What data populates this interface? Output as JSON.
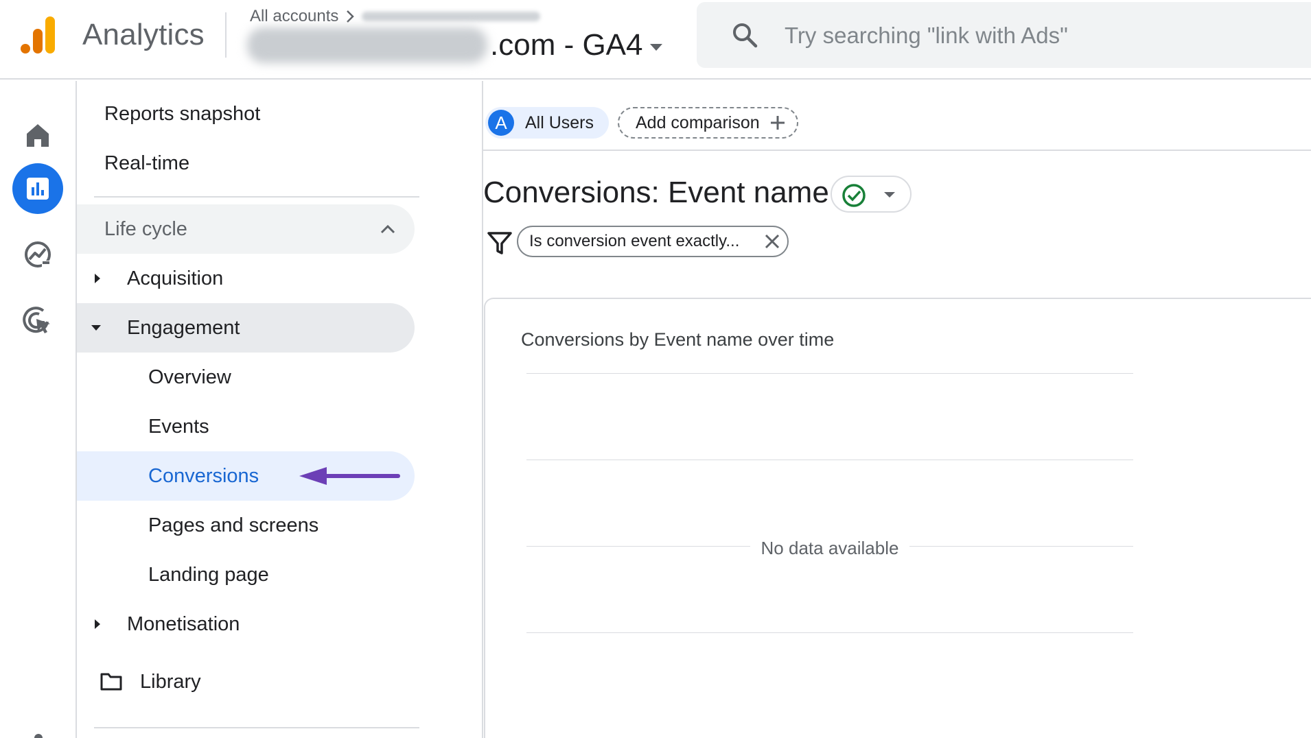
{
  "header": {
    "app_title": "Analytics",
    "breadcrumb_all_accounts": "All accounts",
    "property_suffix": ".com - GA4",
    "search_placeholder": "Try searching \"link with Ads\""
  },
  "rail": {
    "icons": [
      "home-icon",
      "reports-icon",
      "explore-icon",
      "advertising-icon"
    ],
    "active": "reports-icon"
  },
  "nav": {
    "reports_snapshot": "Reports snapshot",
    "realtime": "Real-time",
    "life_cycle": "Life cycle",
    "acquisition": "Acquisition",
    "engagement": "Engagement",
    "overview": "Overview",
    "events": "Events",
    "conversions": "Conversions",
    "pages_and_screens": "Pages and screens",
    "landing_page": "Landing page",
    "monetisation": "Monetisation",
    "library": "Library"
  },
  "main": {
    "comparison_avatar": "A",
    "all_users": "All Users",
    "add_comparison": "Add comparison",
    "report_title": "Conversions: Event name",
    "filter_text": "Is conversion event exactly...",
    "card_title": "Conversions by Event name over time",
    "no_data": "No data available"
  },
  "colors": {
    "accent_blue": "#1a73e8",
    "selected_bg": "#e8f0fe",
    "arrow_purple": "#6c3fb6",
    "check_green": "#188038",
    "logo_orange": "#f9ab00",
    "logo_dark_orange": "#e37400"
  }
}
